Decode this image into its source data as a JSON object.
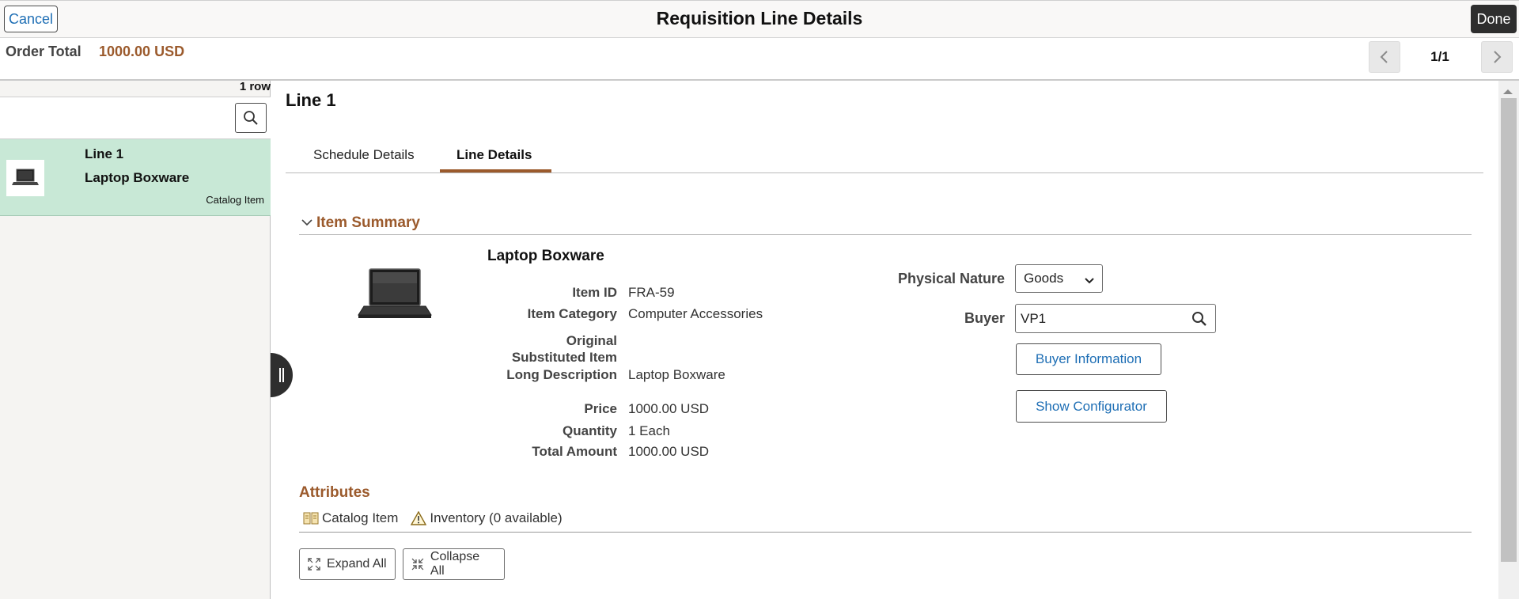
{
  "header": {
    "cancel_label": "Cancel",
    "title": "Requisition Line Details",
    "done_label": "Done"
  },
  "order_total": {
    "label": "Order Total",
    "value": "1000.00 USD"
  },
  "pager": {
    "count": "1/1"
  },
  "left_panel": {
    "row_count": "1 row",
    "item": {
      "title": "Line 1",
      "name": "Laptop Boxware",
      "type": "Catalog Item"
    }
  },
  "detail": {
    "line_title": "Line 1",
    "tabs": [
      {
        "label": "Schedule Details"
      },
      {
        "label": "Line Details"
      }
    ],
    "active_tab": "Line Details",
    "section_title": "Item Summary",
    "item_name": "Laptop Boxware",
    "fields": {
      "item_id": {
        "label": "Item ID",
        "value": "FRA-59"
      },
      "item_category": {
        "label": "Item Category",
        "value": "Computer Accessories"
      },
      "original_sub_line1": "Original",
      "original_sub_line2": "Substituted Item",
      "long_description": {
        "label": "Long Description",
        "value": "Laptop Boxware"
      },
      "price": {
        "label": "Price",
        "value": "1000.00 USD"
      },
      "quantity": {
        "label": "Quantity",
        "value": "1 Each"
      },
      "total_amount": {
        "label": "Total Amount",
        "value": "1000.00 USD"
      }
    },
    "physical_nature": {
      "label": "Physical Nature",
      "value": "Goods"
    },
    "buyer": {
      "label": "Buyer",
      "value": "VP1"
    },
    "buyer_info_label": "Buyer Information",
    "configurator_label": "Show Configurator",
    "attributes": {
      "title": "Attributes",
      "catalog_item": "Catalog Item",
      "inventory": "Inventory (0 available)"
    },
    "expand_all_label": "Expand All",
    "collapse_all_label": "Collapse All"
  },
  "colors": {
    "accent": "#9b5a2c",
    "link": "#1f6fb5",
    "selected_row": "#c8e8d6",
    "dark_button": "#2e2e2e"
  }
}
